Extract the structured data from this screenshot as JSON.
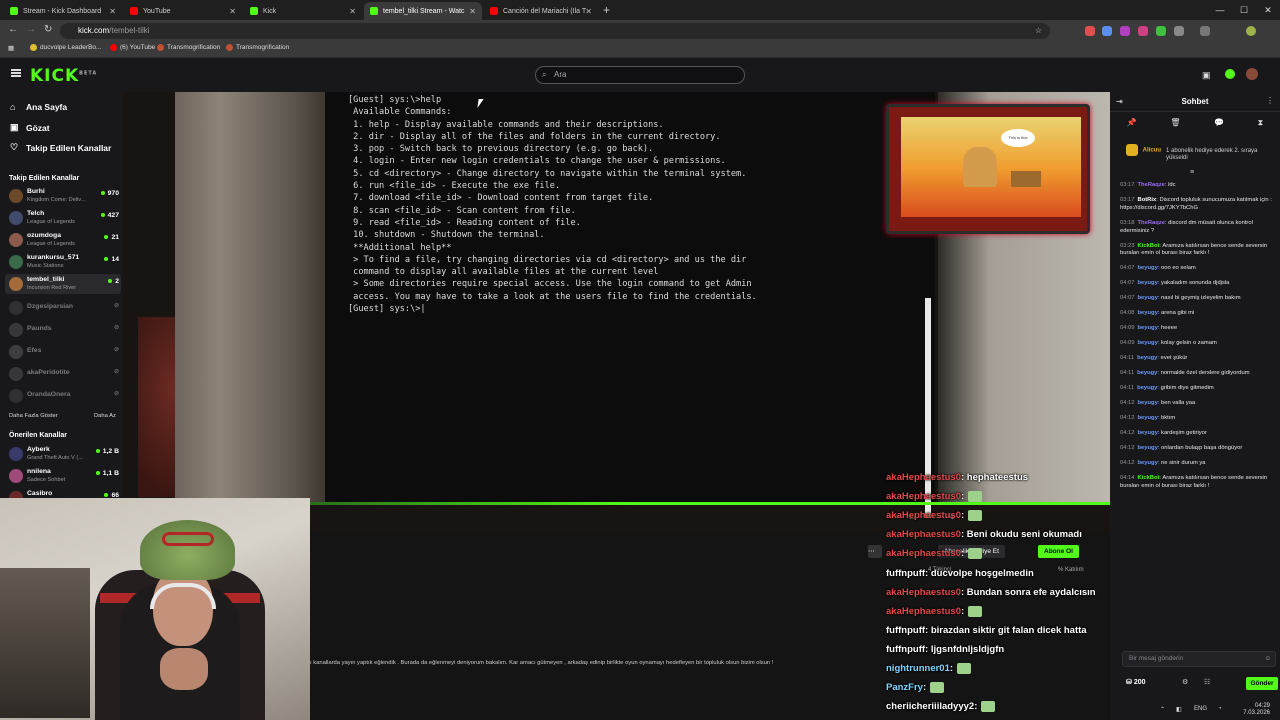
{
  "browser": {
    "tabs": [
      {
        "label": "Stream - Kick Dashboard",
        "color": "#53fc18"
      },
      {
        "label": "YouTube",
        "color": "#ff0000"
      },
      {
        "label": "Kick",
        "color": "#53fc18"
      },
      {
        "label": "tembel_tilki Stream - Watc",
        "color": "#53fc18"
      },
      {
        "label": "Canción del Mariachi (Ila T",
        "color": "#ff0000"
      }
    ],
    "url": "kick.com",
    "url_path": "/tembel-tilki",
    "bookmarks": [
      {
        "label": "ducvolpe LeaderBo...",
        "color": "#e0c030"
      },
      {
        "label": "(6) YouTube",
        "color": "#ff0000"
      },
      {
        "label": "Transmogrification",
        "color": "#c05030"
      },
      {
        "label": "Transmogrification",
        "color": "#c05030"
      }
    ]
  },
  "kick": {
    "logo": "KICK",
    "logo_badge": "BETA",
    "search_placeholder": "Ara"
  },
  "sidebar": {
    "nav": [
      {
        "icon": "home-icon",
        "label": "Ana Sayfa"
      },
      {
        "icon": "compass-icon",
        "label": "Gözat"
      },
      {
        "icon": "heart-icon",
        "label": "Takip Edilen Kanallar"
      }
    ],
    "following_title": "Takip Edilen Kanallar",
    "following": [
      {
        "name": "Burhi",
        "game": "Kingdom Come: Deliv...",
        "viewers": "970",
        "color": "#6b4a2a"
      },
      {
        "name": "Telch",
        "game": "League of Legends",
        "viewers": "427",
        "color": "#404a6a"
      },
      {
        "name": "ozumdoga",
        "game": "League of Legends",
        "viewers": "21",
        "color": "#8a5a4a"
      },
      {
        "name": "kurankursu_571",
        "game": "Music Stations",
        "viewers": "14",
        "color": "#3a6a4a"
      },
      {
        "name": "tembel_tilki",
        "game": "Incursion Red River",
        "viewers": "2",
        "color": "#a46a3a"
      }
    ],
    "offline": [
      {
        "name": "Dzgesiparsian",
        "color": "#555"
      },
      {
        "name": "Paunds",
        "color": "#666"
      },
      {
        "name": "Efes",
        "color": "#777"
      },
      {
        "name": "akaPeridotite",
        "color": "#666"
      },
      {
        "name": "OrandaOnera",
        "color": "#555"
      }
    ],
    "show_more": "Daha Fazla Göster",
    "show_less": "Daha Az",
    "recommended_title": "Önerilen Kanallar",
    "recommended": [
      {
        "name": "Ayberk",
        "game": "Grand Theft Auto V (...",
        "viewers": "1,2 B",
        "color": "#3a3a6a"
      },
      {
        "name": "nnilena",
        "game": "Sadece Sohbet",
        "viewers": "1,1 B",
        "color": "#a04a7a"
      },
      {
        "name": "Casibro",
        "game": "",
        "viewers": "66",
        "color": "#6a2a2a"
      }
    ]
  },
  "terminal": [
    "[Guest] sys:\\>help",
    " Available Commands:",
    "",
    " 1. help - Display available commands and their descriptions.",
    " 2. dir - Display all of the files and folders in the current directory.",
    " 3. pop - Switch back to previous directory (e.g. go back).",
    " 4. login - Enter new login credentials to change the user & permissions.",
    " 5. cd <directory> - Change directory to navigate within the terminal system.",
    " 6. run <file_id> - Execute the exe file.",
    " 7. download <file_id> - Download content from target file.",
    " 8. scan <file_id> - Scan content from file.",
    " 9. read <file_id> - Reading content of file.",
    " 10. shutdown - Shutdown the terminal.",
    "",
    " **Additional help**",
    "",
    " > To find a file, try changing directories via cd <directory> and us the dir",
    " command to display all available files at the current level",
    " > Some directories require special access. Use the login command to get Admin",
    " access. You may have to take a look at the users file to find the credentials.",
    "[Guest] sys:\\>|"
  ],
  "meme_bubble": "This is fine",
  "ticker": "ı kanallarda yayın yaptık eğlendik . Burada da eğlenmeyi deniyorum bakalım. Kar amacı gütmeyen , arkadaş edinip birlikte oyun oynamayı hedefleyen bir topluluk olsun bizim olsun !",
  "overlay_chat": [
    {
      "user": "akaHephaestus0",
      "text": ": hephateestus",
      "emote": false,
      "user_color": "#e54848"
    },
    {
      "user": "akaHephaestus0",
      "text": ":",
      "emote": true,
      "user_color": "#e54848"
    },
    {
      "user": "akaHephaestus0",
      "text": ":",
      "emote": true,
      "user_color": "#e54848"
    },
    {
      "user": "akaHephaestus0",
      "text": ": Beni okudu seni okumadı",
      "emote": false,
      "user_color": "#e54848"
    },
    {
      "user": "akaHephaestus0",
      "text": ":",
      "emote": true,
      "user_color": "#e54848"
    },
    {
      "user": "fuffnpuff",
      "text": ": ducvolpe hoşgelmedin",
      "emote": false,
      "user_color": "#ffffff"
    },
    {
      "user": "akaHephaestus0",
      "text": ": Bundan sonra efe aydalcısın",
      "emote": false,
      "user_color": "#e54848"
    },
    {
      "user": "akaHephaestus0",
      "text": ":",
      "emote": true,
      "user_color": "#e54848"
    },
    {
      "user": "fuffnpuff",
      "text": ": birazdan siktir git falan dicek hatta",
      "emote": false,
      "user_color": "#ffffff"
    },
    {
      "user": "fuffnpuff",
      "text": ": ljgsnfdnljsldjgfn",
      "emote": false,
      "user_color": "#ffffff"
    },
    {
      "user": "nightrunner01",
      "text": ":",
      "emote": true,
      "user_color": "#7ed6ff"
    },
    {
      "user": "PanzFry",
      "text": ":",
      "emote": true,
      "user_color": "#7ed6ff"
    },
    {
      "user": "cheriicheriiiladyyy2",
      "text": ":",
      "emote": true,
      "user_color": "#ffffff"
    }
  ],
  "subs": {
    "gift": "Abonelik Hediye Et",
    "subscribe": "Abone Ol",
    "followers": "4 Takipçi",
    "rate": "% Katılım"
  },
  "chat": {
    "title": "Sohbet",
    "pinned_user": "Alicuu",
    "pinned_text": "1 abonelik hediye ederek 2. sıraya yükseldi",
    "messages": [
      {
        "time": "03:17",
        "user": "TheRaqze",
        "color": "#9b6bff",
        "text": "ldc"
      },
      {
        "time": "03:17",
        "user": "BotRix",
        "color": "#ffffff",
        "text": "Discord topluluk sunucumuza katılmak için : https://discord.gg/7JKY7bChG"
      },
      {
        "time": "03:18",
        "user": "TheRaqze",
        "color": "#9b6bff",
        "text": "discord dm müsait olunca kontrol edermisiniz ?"
      },
      {
        "time": "03:23",
        "user": "KickBot",
        "color": "#53fc18",
        "text": "Aramıza katılırsan bence sende seversin buraları emin ol burası biraz farklı !"
      },
      {
        "time": "04:07",
        "user": "beyugy",
        "color": "#6b9bff",
        "text": "ooo eo selam"
      },
      {
        "time": "04:07",
        "user": "beyugy",
        "color": "#6b9bff",
        "text": "yakaladım sonunda djdjsla"
      },
      {
        "time": "04:07",
        "user": "beyugy",
        "color": "#6b9bff",
        "text": "nasıl bi geymiş izleyelim bakım"
      },
      {
        "time": "04:08",
        "user": "beyugy",
        "color": "#6b9bff",
        "text": "arena gibi mi"
      },
      {
        "time": "04:09",
        "user": "beyugy",
        "color": "#6b9bff",
        "text": "heeee"
      },
      {
        "time": "04:09",
        "user": "beyugy",
        "color": "#6b9bff",
        "text": "kolay gelsin o zamam"
      },
      {
        "time": "04:11",
        "user": "beyugy",
        "color": "#6b9bff",
        "text": "evet şükür"
      },
      {
        "time": "04:11",
        "user": "beyugy",
        "color": "#6b9bff",
        "text": "normalde özel derslere gidiyordum"
      },
      {
        "time": "04:11",
        "user": "beyugy",
        "color": "#6b9bff",
        "text": "gribim diye gitmedim"
      },
      {
        "time": "04:12",
        "user": "beyugy",
        "color": "#6b9bff",
        "text": "ben valla yaa"
      },
      {
        "time": "04:12",
        "user": "beyugy",
        "color": "#6b9bff",
        "text": "bktım"
      },
      {
        "time": "04:12",
        "user": "beyugy",
        "color": "#6b9bff",
        "text": "kardeşim getiriyor"
      },
      {
        "time": "04:12",
        "user": "beyugy",
        "color": "#6b9bff",
        "text": "onlardan bulaşp başa döngüyor"
      },
      {
        "time": "04:12",
        "user": "beyugy",
        "color": "#6b9bff",
        "text": "ne sinir durum ya"
      },
      {
        "time": "04:14",
        "user": "KickBot",
        "color": "#53fc18",
        "text": "Aramıza katılırsan bence sende seversin buraları emin ol burası biraz farklı !"
      }
    ],
    "input_placeholder": "Bir mesaj gönderin",
    "points": "200",
    "send": "Gönder"
  },
  "tray": {
    "lang": "ENG",
    "time": "04:29",
    "date": "7.03.2026"
  }
}
